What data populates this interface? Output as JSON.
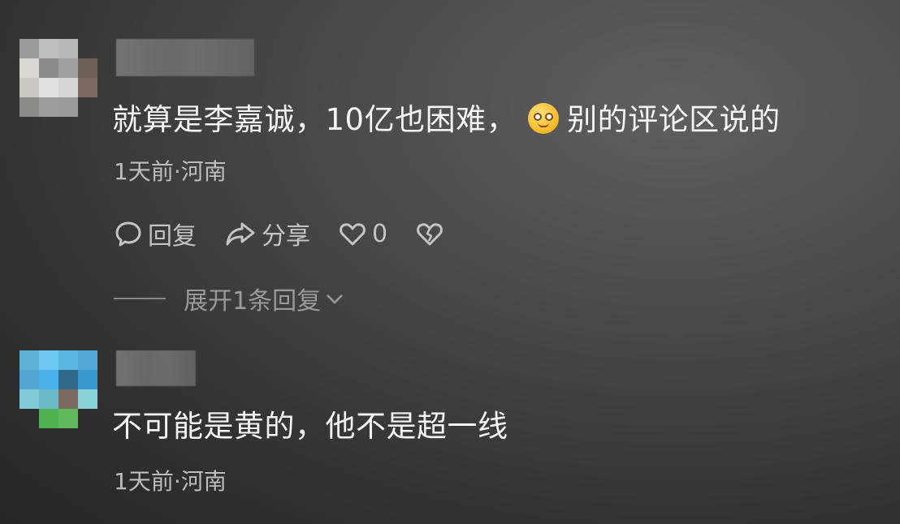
{
  "comments": [
    {
      "content_text": "就算是李嘉诚，10亿也困难，",
      "content_suffix": "别的评论区说的",
      "emoji": "smiling-face-emoji",
      "meta": "1天前·河南",
      "actions": {
        "reply_label": "回复",
        "share_label": "分享",
        "like_count": "0"
      },
      "expand_label": "展开1条回复"
    },
    {
      "content_text": "不可能是黄的，他不是超一线",
      "meta": "1天前·河南"
    }
  ],
  "colors": {
    "background": "#4a4a4a",
    "text_primary": "#f5f5f5",
    "text_secondary": "#bdbdbd",
    "emoji": "#f5b623"
  }
}
